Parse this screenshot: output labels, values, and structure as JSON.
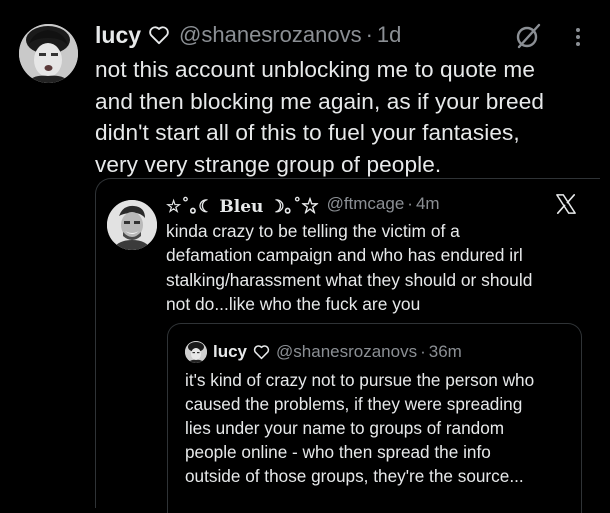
{
  "tweet": {
    "author": {
      "name": "lucy",
      "handle": "@shanesrozanovs",
      "time": "1d"
    },
    "separator": "·",
    "text_lines": [
      "not this account unblocking me to quote me",
      "and then blocking me again, as if your breed",
      "didn't start all of this to fuel your fantasies,",
      "very very strange group of people."
    ]
  },
  "quote": {
    "author": {
      "name": "☆˚｡☾ Bleu ☽｡˚☆",
      "handle": "@ftmcage",
      "time": "4m"
    },
    "separator": "·",
    "text_lines": [
      "kinda crazy to be telling the victim of a",
      "defamation campaign and who has endured irl",
      "stalking/harassment what they should or should",
      "not do...like who the fuck are you"
    ]
  },
  "nested_quote": {
    "author": {
      "name": "lucy",
      "handle": "@shanesrozanovs",
      "time": "36m"
    },
    "separator": "·",
    "text_lines": [
      "it's kind of crazy not to pursue the person who",
      "caused the problems, if they were spreading",
      "lies under your name to groups of random",
      "people online - who then spread the info",
      "outside of those groups, they're the source..."
    ]
  },
  "icons": {
    "grok": "grok-slash-icon",
    "more": "more-vertical-icon",
    "x": "x-logo-icon",
    "heart": "heart-outline-icon"
  },
  "colors": {
    "background": "#000000",
    "text": "#e7e9ea",
    "secondary": "#8b8f94",
    "border": "#2f3336"
  }
}
